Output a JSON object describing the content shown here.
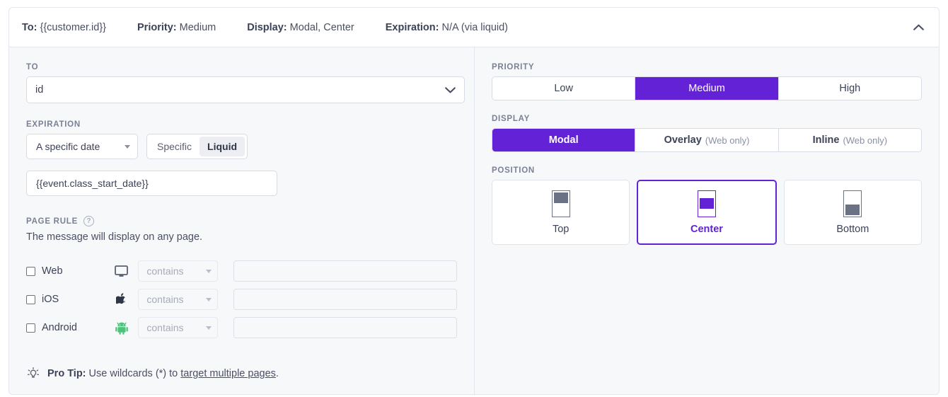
{
  "summary": {
    "items": [
      {
        "key": "To:",
        "value": "{{customer.id}}"
      },
      {
        "key": "Priority:",
        "value": "Medium"
      },
      {
        "key": "Display:",
        "value": "Modal, Center"
      },
      {
        "key": "Expiration:",
        "value": "N/A (via liquid)"
      }
    ],
    "collapse_icon": "chevron-up-icon"
  },
  "left": {
    "to": {
      "label": "TO",
      "value": "id",
      "chevron_icon": "chevron-down-icon"
    },
    "expiration": {
      "label": "EXPIRATION",
      "date_mode": "A specific date",
      "toggle": {
        "specific": "Specific",
        "liquid": "Liquid",
        "active": "Liquid"
      },
      "liquid_value": "{{event.class_start_date}}"
    },
    "page_rule": {
      "label": "PAGE RULE",
      "help_icon": "help-circle-icon",
      "help_glyph": "?",
      "description": "The message will display on any page.",
      "operator": "contains",
      "platforms": [
        {
          "name": "Web",
          "icon": "monitor-icon",
          "checked": false,
          "operator": "contains",
          "value": ""
        },
        {
          "name": "iOS",
          "icon": "apple-icon",
          "checked": false,
          "operator": "contains",
          "value": ""
        },
        {
          "name": "Android",
          "icon": "android-icon",
          "checked": false,
          "operator": "contains",
          "value": ""
        }
      ]
    },
    "pro_tip": {
      "icon": "lightbulb-icon",
      "label": "Pro Tip:",
      "text": "Use wildcards (*) to",
      "link": "target multiple pages",
      "suffix": "."
    }
  },
  "right": {
    "priority": {
      "label": "PRIORITY",
      "options": [
        "Low",
        "Medium",
        "High"
      ],
      "selected": "Medium"
    },
    "display": {
      "label": "DISPLAY",
      "options": [
        {
          "name": "Modal",
          "note": ""
        },
        {
          "name": "Overlay",
          "note": "(Web only)"
        },
        {
          "name": "Inline",
          "note": "(Web only)"
        }
      ],
      "selected": "Modal"
    },
    "position": {
      "label": "POSITION",
      "options": [
        "Top",
        "Center",
        "Bottom"
      ],
      "selected": "Center"
    }
  },
  "colors": {
    "accent": "#6422d6",
    "android_green": "#4dc37a",
    "text": "#3c4257",
    "muted": "#7b8194",
    "panel_bg": "#f7f8fa"
  }
}
